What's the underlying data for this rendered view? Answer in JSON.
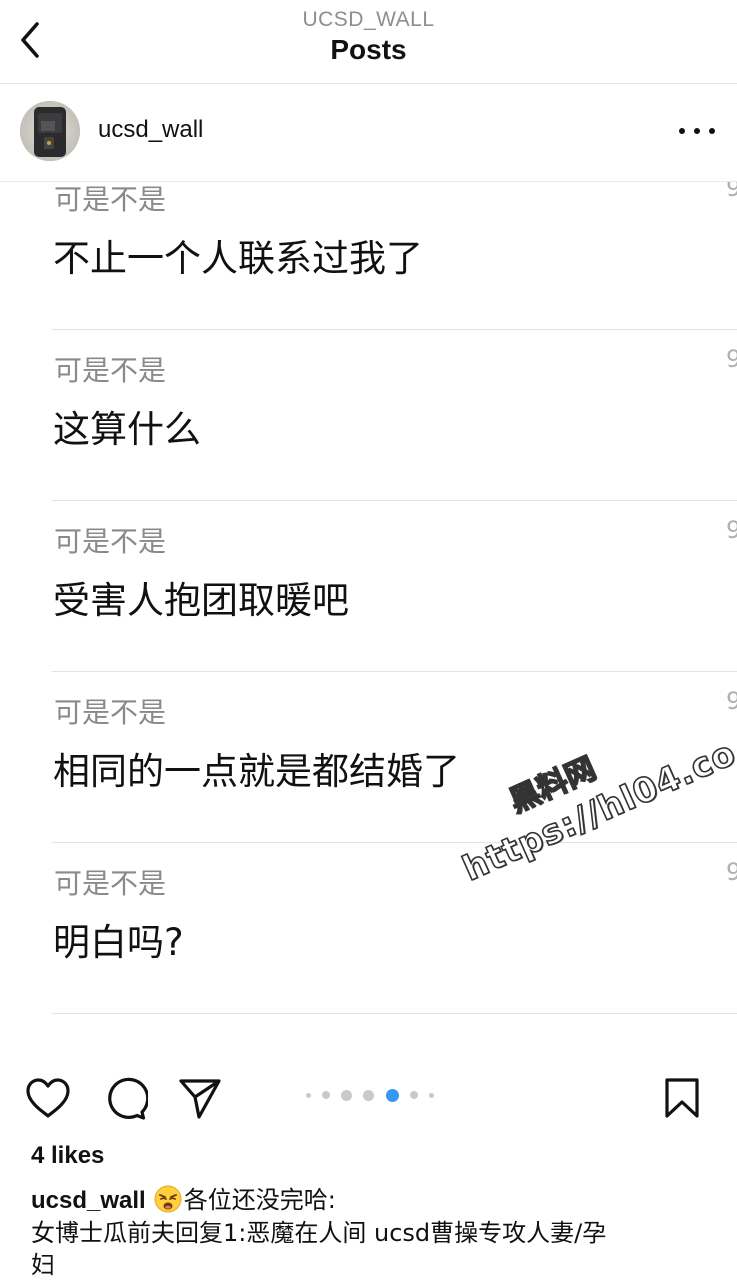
{
  "header": {
    "kicker": "UCSD_WALL",
    "title": "Posts",
    "back_icon": "chevron-left-icon"
  },
  "account": {
    "username": "ucsd_wall",
    "more_icon": "more-horizontal-icon"
  },
  "post_image": {
    "messages": [
      {
        "sender": "可是不是",
        "text": "不止一个人联系过我了",
        "time": "9"
      },
      {
        "sender": "可是不是",
        "text": "这算什么",
        "time": "9"
      },
      {
        "sender": "可是不是",
        "text": "受害人抱团取暖吧",
        "time": "9"
      },
      {
        "sender": "可是不是",
        "text": "相同的一点就是都结婚了",
        "time": "9"
      },
      {
        "sender": "可是不是",
        "text": "明白吗?",
        "time": "9"
      }
    ],
    "watermark": {
      "line1": "黑料网",
      "line2": "https://hl04.co"
    }
  },
  "actions": {
    "like_icon": "heart-icon",
    "comment_icon": "comment-icon",
    "share_icon": "send-icon",
    "save_icon": "bookmark-icon",
    "carousel": {
      "total": 7,
      "active_index": 4
    }
  },
  "likes": "4 likes",
  "caption": {
    "username": "ucsd_wall",
    "emoji": "weary-face-emoji",
    "line1": "各位还没完哈:",
    "line2": "女博士瓜前夫回复1:恶魔在人间 ucsd曹操专攻人妻/孕",
    "line3": "妇"
  },
  "colors": {
    "text": "#111111",
    "muted": "#8e8e8e",
    "divider": "#e3e3e3",
    "carousel_active": "#3897f0",
    "carousel_inactive": "#c9c9c9"
  }
}
